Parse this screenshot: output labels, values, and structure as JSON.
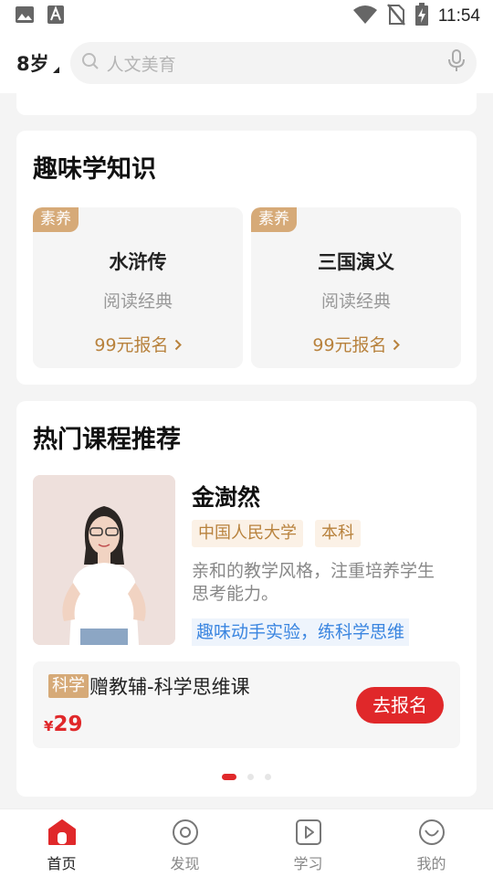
{
  "status_bar": {
    "time": "11:54",
    "icons": [
      "image-icon",
      "font-a-icon",
      "wifi-icon",
      "no-sim-icon",
      "battery-charging-icon"
    ]
  },
  "header": {
    "age": "8岁",
    "search_placeholder": "人文美育",
    "icons": [
      "search-icon",
      "microphone-icon"
    ]
  },
  "fun_section": {
    "title": "趣味学知识",
    "items": [
      {
        "badge": "素养",
        "title": "水浒传",
        "subtitle": "阅读经典",
        "price": "99元报名"
      },
      {
        "badge": "素养",
        "title": "三国演义",
        "subtitle": "阅读经典",
        "price": "99元报名"
      }
    ]
  },
  "hot_section": {
    "title": "热门课程推荐",
    "teacher": {
      "name": "金澍然",
      "tags": [
        "中国人民大学",
        "本科"
      ],
      "description": "亲和的教学风格，注重培养学生思考能力。",
      "slogan": "趣味动手实验，练科学思维"
    },
    "course": {
      "tag": "科学",
      "title": "赠教辅-科学思维课",
      "price_symbol": "¥",
      "price": "29",
      "button": "去报名"
    },
    "carousel": {
      "count": 3,
      "active_index": 0
    }
  },
  "bottom_nav": {
    "active_index": 0,
    "items": [
      {
        "label": "首页",
        "icon": "home-icon"
      },
      {
        "label": "发现",
        "icon": "discover-icon"
      },
      {
        "label": "学习",
        "icon": "play-icon"
      },
      {
        "label": "我的",
        "icon": "profile-icon"
      }
    ]
  },
  "colors": {
    "accent": "#e0282a",
    "gold": "#b8823d",
    "badge": "#d6aa78",
    "link_blue": "#3a85e0"
  }
}
